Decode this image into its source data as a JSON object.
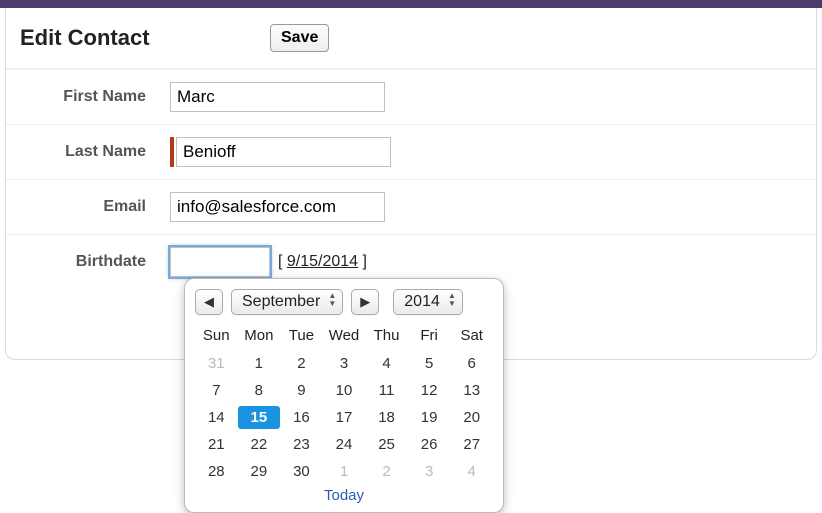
{
  "header": {
    "title": "Edit Contact",
    "save_label": "Save"
  },
  "form": {
    "first_name": {
      "label": "First Name",
      "value": "Marc"
    },
    "last_name": {
      "label": "Last Name",
      "value": "Benioff"
    },
    "email": {
      "label": "Email",
      "value": "info@salesforce.com"
    },
    "birthdate": {
      "label": "Birthdate",
      "value": "",
      "helper": "9/15/2014"
    }
  },
  "datepicker": {
    "month": "September",
    "year": "2014",
    "dow": [
      "Sun",
      "Mon",
      "Tue",
      "Wed",
      "Thu",
      "Fri",
      "Sat"
    ],
    "cells": [
      {
        "n": "31",
        "muted": true
      },
      {
        "n": "1"
      },
      {
        "n": "2"
      },
      {
        "n": "3"
      },
      {
        "n": "4"
      },
      {
        "n": "5"
      },
      {
        "n": "6"
      },
      {
        "n": "7"
      },
      {
        "n": "8"
      },
      {
        "n": "9"
      },
      {
        "n": "10"
      },
      {
        "n": "11"
      },
      {
        "n": "12"
      },
      {
        "n": "13"
      },
      {
        "n": "14"
      },
      {
        "n": "15",
        "selected": true
      },
      {
        "n": "16"
      },
      {
        "n": "17"
      },
      {
        "n": "18"
      },
      {
        "n": "19"
      },
      {
        "n": "20"
      },
      {
        "n": "21"
      },
      {
        "n": "22"
      },
      {
        "n": "23"
      },
      {
        "n": "24"
      },
      {
        "n": "25"
      },
      {
        "n": "26"
      },
      {
        "n": "27"
      },
      {
        "n": "28"
      },
      {
        "n": "29"
      },
      {
        "n": "30"
      },
      {
        "n": "1",
        "muted": true
      },
      {
        "n": "2",
        "muted": true
      },
      {
        "n": "3",
        "muted": true
      },
      {
        "n": "4",
        "muted": true
      }
    ],
    "today_label": "Today",
    "prev_glyph": "◀",
    "next_glyph": "▶"
  }
}
